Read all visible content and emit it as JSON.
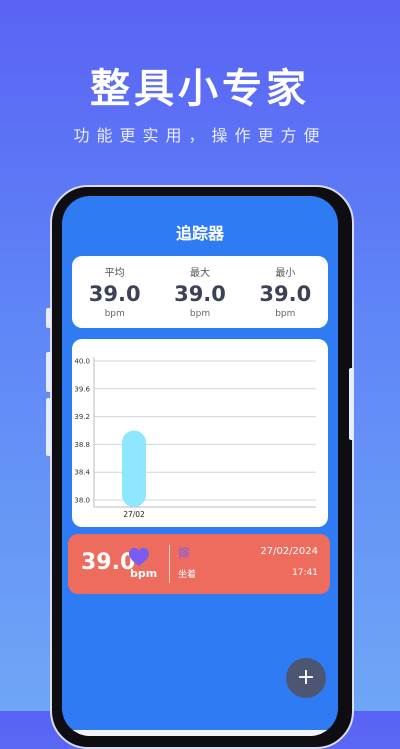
{
  "promo": {
    "title": "整具小专家",
    "subtitle": "功能更实用，操作更方便"
  },
  "app": {
    "title": "追踪器"
  },
  "stats": [
    {
      "label": "平均",
      "value": "39.0",
      "unit": "bpm"
    },
    {
      "label": "最大",
      "value": "39.0",
      "unit": "bpm"
    },
    {
      "label": "最小",
      "value": "39.0",
      "unit": "bpm"
    }
  ],
  "chart_data": {
    "type": "bar",
    "categories": [
      "27/02"
    ],
    "values": [
      39.0
    ],
    "ylim": [
      37.9,
      40.0
    ],
    "yticks": [
      "40.0",
      "39.6",
      "39.2",
      "38.8",
      "38.4",
      "38.0"
    ],
    "xlabel": "",
    "ylabel": "",
    "grid": true,
    "bar_color": "#8ee6ff"
  },
  "record": {
    "value": "39.0",
    "unit": "bpm",
    "mood": "嫁",
    "posture": "坐着",
    "date": "27/02/2024",
    "time": "17:41",
    "card_color": "#ee6c5e",
    "heart_color": "#7b5cf0"
  },
  "fab": {
    "label": "+"
  }
}
